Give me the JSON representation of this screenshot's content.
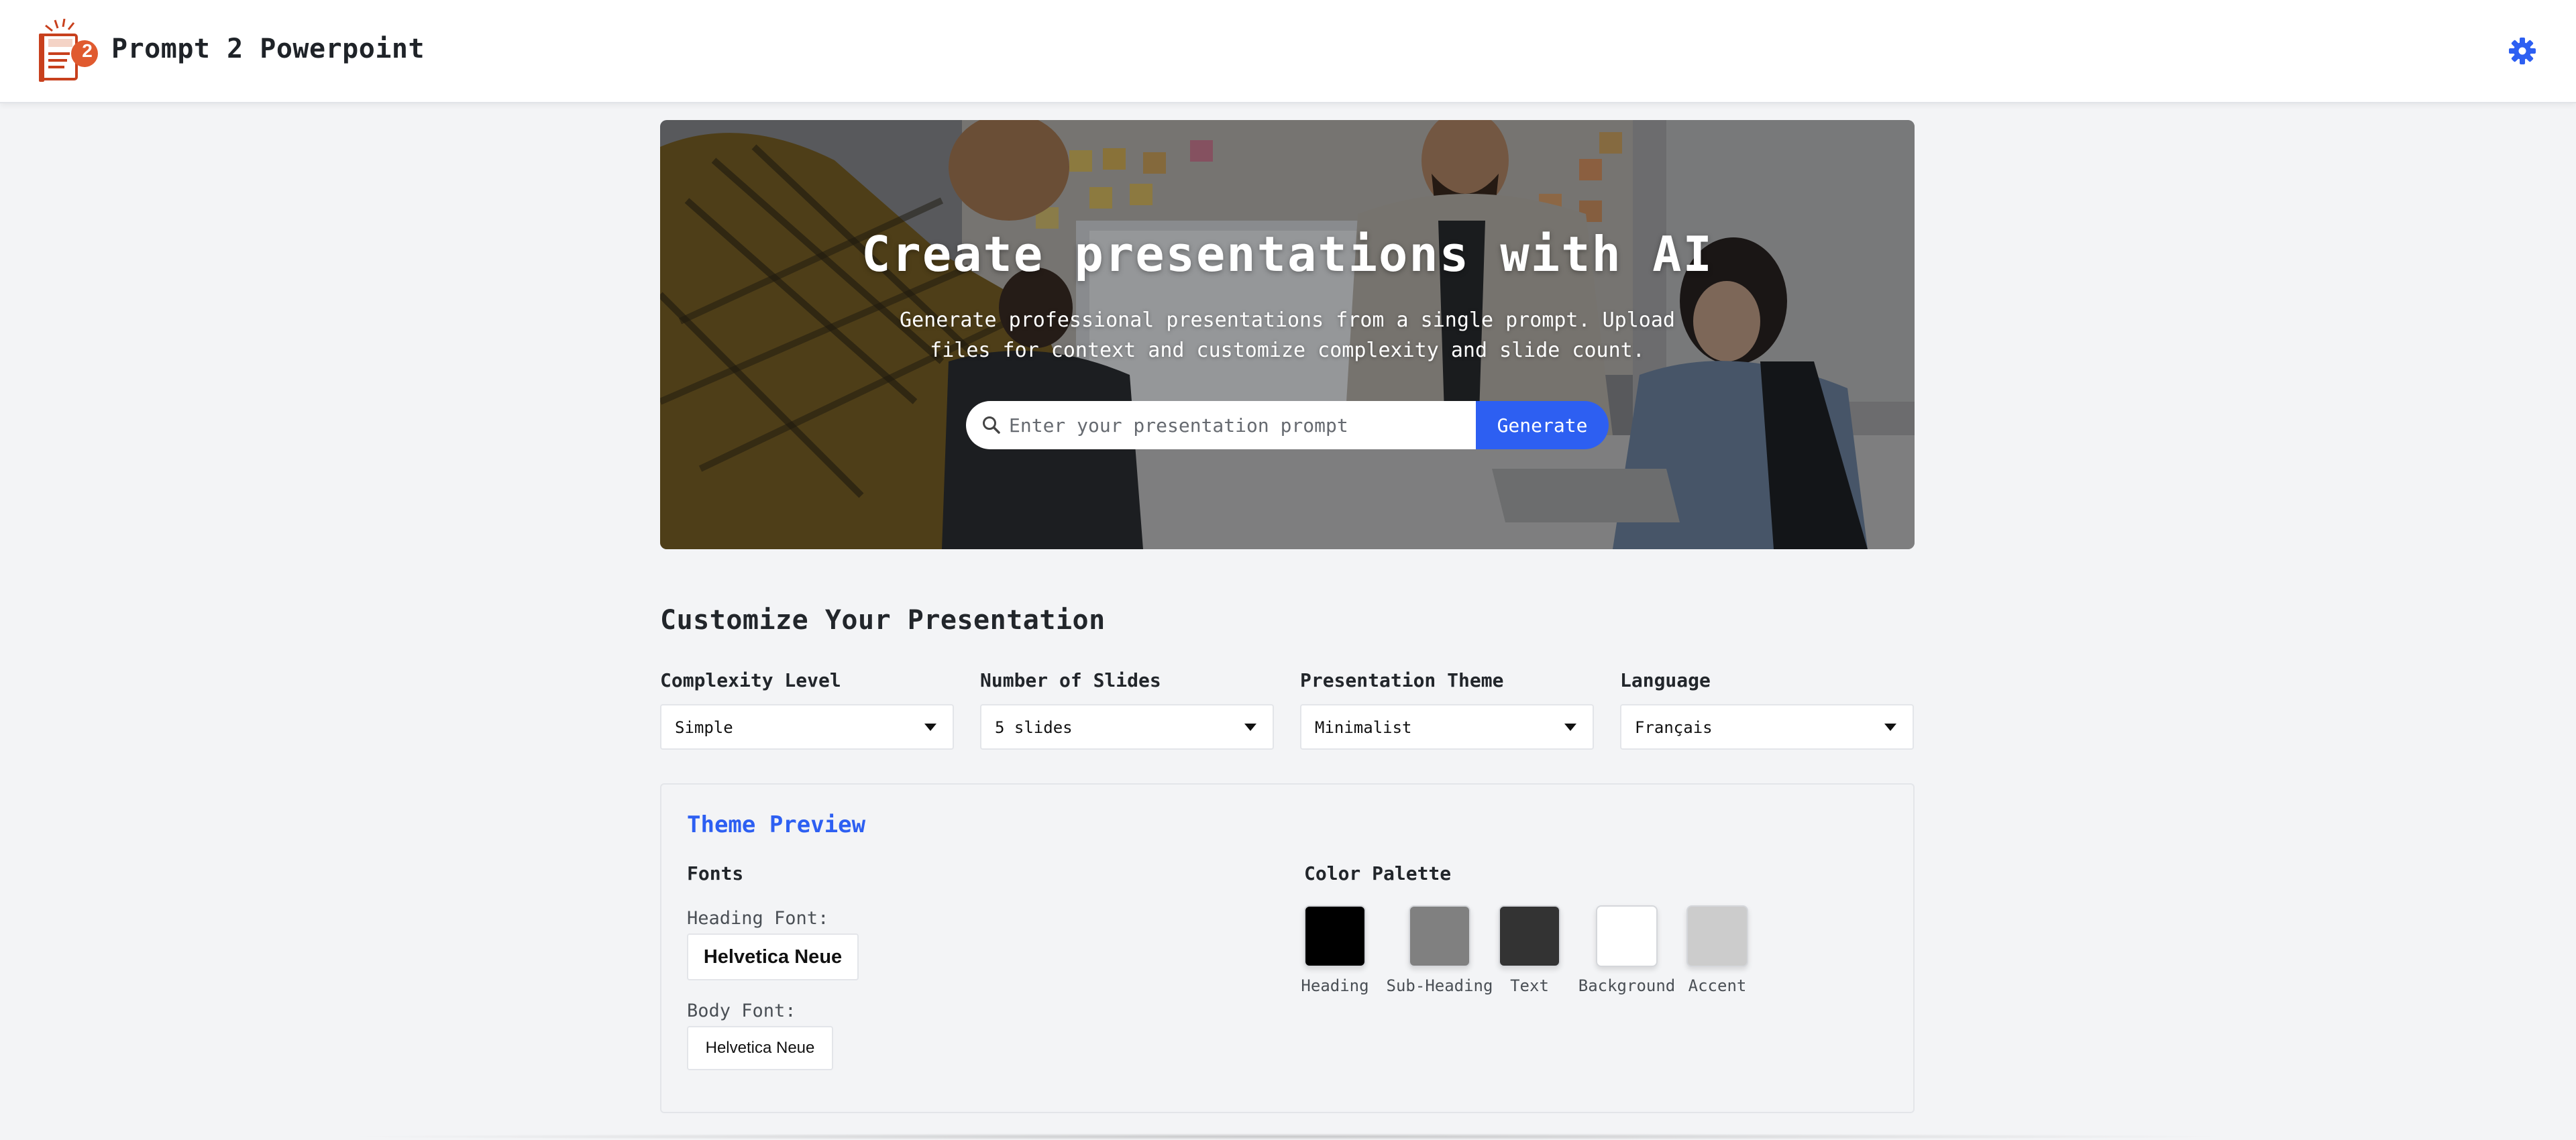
{
  "header": {
    "app_title": "Prompt 2 Powerpoint",
    "logo_icon": "presentation-book-logo",
    "logo_badge": "2",
    "settings_icon": "gear-icon"
  },
  "hero": {
    "title": "Create presentations with AI",
    "subtitle": "Generate professional presentations from a single prompt. Upload files for context and customize complexity and slide count.",
    "prompt_placeholder": "Enter your presentation prompt",
    "prompt_value": "",
    "search_icon": "search-icon",
    "generate_label": "Generate"
  },
  "customize": {
    "title": "Customize Your Presentation",
    "complexity": {
      "label": "Complexity Level",
      "value": "Simple"
    },
    "slides": {
      "label": "Number of Slides",
      "value": "5 slides"
    },
    "theme": {
      "label": "Presentation Theme",
      "value": "Minimalist"
    },
    "language": {
      "label": "Language",
      "value": "Français"
    }
  },
  "theme_preview": {
    "title": "Theme Preview",
    "fonts_title": "Fonts",
    "heading_font_label": "Heading Font:",
    "heading_font": "Helvetica Neue",
    "body_font_label": "Body Font:",
    "body_font": "Helvetica Neue",
    "palette_title": "Color Palette",
    "palette": [
      {
        "name": "Heading",
        "color": "#000000"
      },
      {
        "name": "Sub-Heading",
        "color": "#808080"
      },
      {
        "name": "Text",
        "color": "#333333"
      },
      {
        "name": "Background",
        "color": "#ffffff"
      },
      {
        "name": "Accent",
        "color": "#cccccc"
      }
    ]
  },
  "colors": {
    "accent": "#2d5ff2",
    "page_bg": "#f3f4f6"
  }
}
